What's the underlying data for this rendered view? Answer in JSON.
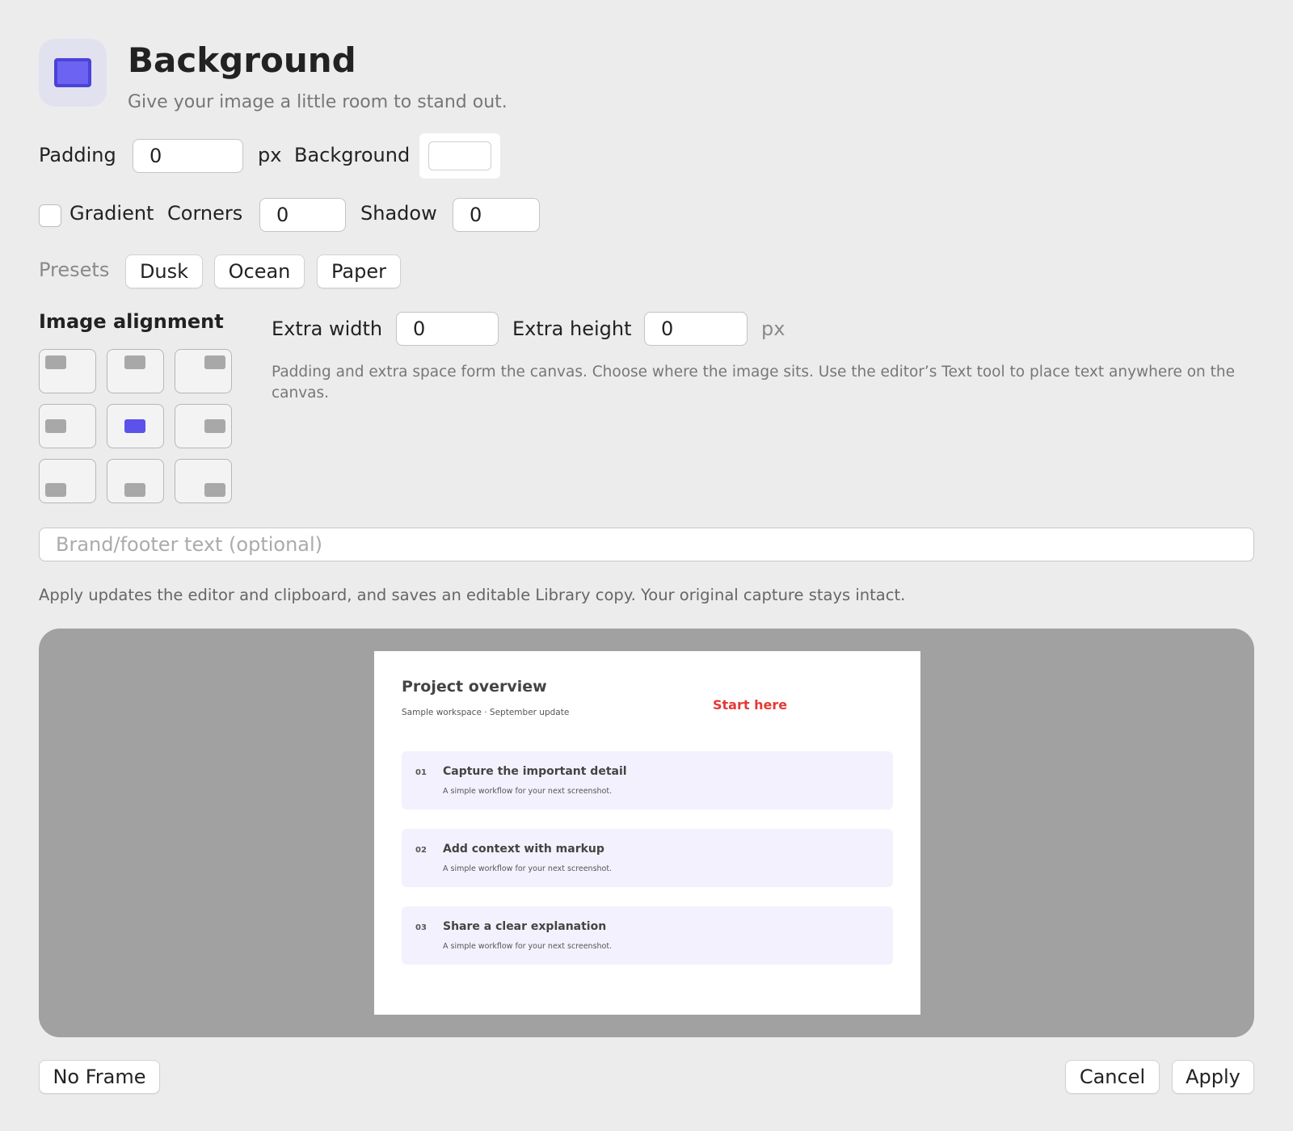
{
  "header": {
    "icon": "display-icon",
    "title": "Background",
    "subtitle": "Give your image a little room to stand out."
  },
  "padding": {
    "label": "Padding",
    "value": "0",
    "unit": "px"
  },
  "background": {
    "label": "Background",
    "color": "#ffffff"
  },
  "gradient": {
    "label": "Gradient",
    "checked": false
  },
  "corners": {
    "label": "Corners",
    "value": "0"
  },
  "shadow": {
    "label": "Shadow",
    "value": "0"
  },
  "presets": {
    "label": "Presets",
    "items": [
      "Dusk",
      "Ocean",
      "Paper"
    ]
  },
  "alignment": {
    "title": "Image alignment",
    "selected": "center",
    "cells": [
      "top-left",
      "top",
      "top-right",
      "left",
      "center",
      "right",
      "bottom-left",
      "bottom",
      "bottom-right"
    ]
  },
  "extra": {
    "width_label": "Extra width",
    "width_value": "0",
    "height_label": "Extra height",
    "height_value": "0",
    "unit": "px"
  },
  "help_text": "Padding and extra space form the canvas. Choose where the image sits. Use the editor’s Text tool to place text anywhere on the canvas.",
  "brand": {
    "placeholder": "Brand/footer text (optional)",
    "value": ""
  },
  "apply_note": "Apply updates the editor and clipboard, and saves an editable Library copy. Your original capture stays intact.",
  "preview": {
    "title": "Project overview",
    "subtitle": "Sample workspace · September update",
    "annotation": "Start here",
    "annotation_color": "#e53935",
    "steps": [
      {
        "num": "01",
        "title": "Capture the important detail",
        "desc": "A simple workflow for your next screenshot."
      },
      {
        "num": "02",
        "title": "Add context with markup",
        "desc": "A simple workflow for your next screenshot."
      },
      {
        "num": "03",
        "title": "Share a clear explanation",
        "desc": "A simple workflow for your next screenshot."
      }
    ]
  },
  "footer": {
    "no_frame": "No Frame",
    "cancel": "Cancel",
    "apply": "Apply"
  },
  "colors": {
    "accent": "#5a52ea",
    "preview_bg": "#a1a1a1",
    "window_bg": "#ececec"
  }
}
